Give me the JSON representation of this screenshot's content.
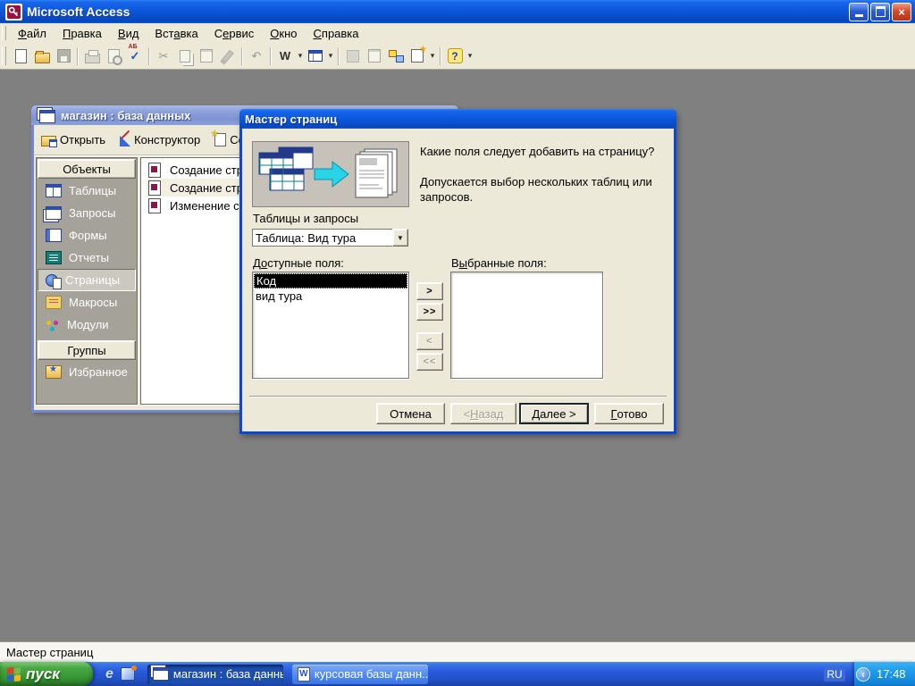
{
  "colors": {
    "active_title": "#0d57dd",
    "inactive_title": "#8ea2dc",
    "window_frame": "#0d47cf",
    "dialog_bg": "#ece9d8",
    "workspace": "#808080",
    "taskbar_blue": "#2a5ade",
    "start_green": "#3b9b36",
    "tray_blue": "#1488dc",
    "selection": "#000000",
    "task_active": "#1c4eb0",
    "task_inactive": "#4c86ee"
  },
  "app": {
    "title": "Microsoft Access"
  },
  "menubar": {
    "items": [
      "Файл",
      "Правка",
      "Вид",
      "Вставка",
      "Сервис",
      "Окно",
      "Справка"
    ]
  },
  "toolbar": {
    "icons": [
      "new",
      "open",
      "save",
      "print",
      "print-preview",
      "spelling",
      "cut",
      "copy",
      "paste",
      "format-painter",
      "undo",
      "office-links",
      "analyze",
      "code",
      "properties",
      "relationships",
      "new-object",
      "help"
    ]
  },
  "db_window": {
    "title": "магазин : база данных",
    "toolbar": {
      "open": "Открыть",
      "design": "Конструктор",
      "create": "Создать"
    },
    "sidebar": {
      "objects_header": "Объекты",
      "objects": [
        "Таблицы",
        "Запросы",
        "Формы",
        "Отчеты",
        "Страницы",
        "Макросы",
        "Модули"
      ],
      "selected": "Страницы",
      "groups_header": "Группы",
      "groups": [
        "Избранное"
      ]
    },
    "list": {
      "items": [
        "Создание стра",
        "Создание стра",
        "Изменение сущ"
      ]
    }
  },
  "dialog": {
    "title": "Мастер страниц",
    "prompt_line1": "Какие поля следует добавить на страницу?",
    "prompt_line2": "Допускается выбор нескольких таблиц или запросов.",
    "tables_label": "Таблицы и запросы",
    "combo_value": "Таблица: Вид тура",
    "available_label": "Доступные поля:",
    "selected_label": "Выбранные поля:",
    "available_items": [
      "Код",
      "вид тура"
    ],
    "selected_items": [],
    "transfer": {
      "add": ">",
      "add_all": ">>",
      "remove": "<",
      "remove_all": "<<"
    },
    "buttons": {
      "cancel": "Отмена",
      "back": "< Назад",
      "next": "Далее >",
      "finish": "Готово"
    }
  },
  "statusbar": {
    "text": "Мастер страниц"
  },
  "taskbar": {
    "start_label": "пуск",
    "tasks": [
      {
        "label": "магазин : база данных"
      },
      {
        "label": "курсовая базы данн..."
      }
    ],
    "tray": {
      "language": "RU",
      "time": "17:48"
    }
  },
  "glyphs": {
    "close": "×",
    "dropdown": "▼",
    "small_arrow": "▾",
    "cut": "✂",
    "undo": "↶",
    "check": "✓",
    "help": "?",
    "office_links": "W",
    "chevron_left": "‹"
  }
}
